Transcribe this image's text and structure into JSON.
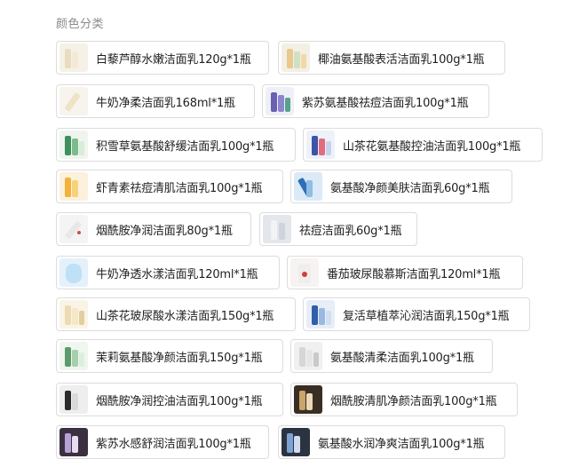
{
  "section_title": "颜色分类",
  "options": [
    {
      "label": "白藜芦醇水嫩洁面乳120g*1瓶",
      "icon": "product-thumbnail"
    },
    {
      "label": "椰油氨基酸表活洁面乳100g*1瓶",
      "icon": "product-thumbnail"
    },
    {
      "label": "牛奶净柔洁面乳168ml*1瓶",
      "icon": "product-thumbnail"
    },
    {
      "label": "紫苏氨基酸祛痘洁面乳100g*1瓶",
      "icon": "product-thumbnail"
    },
    {
      "label": "积雪草氨基酸舒缓洁面乳100g*1瓶",
      "icon": "product-thumbnail"
    },
    {
      "label": "山茶花氨基酸控油洁面乳100g*1瓶",
      "icon": "product-thumbnail"
    },
    {
      "label": "虾青素祛痘清肌洁面乳100g*1瓶",
      "icon": "product-thumbnail"
    },
    {
      "label": "氨基酸净颜美肤洁面乳60g*1瓶",
      "icon": "product-thumbnail"
    },
    {
      "label": "烟酰胺净润洁面乳80g*1瓶",
      "icon": "product-thumbnail"
    },
    {
      "label": "祛痘洁面乳60g*1瓶",
      "icon": "product-thumbnail"
    },
    {
      "label": "牛奶净透水漾洁面乳120ml*1瓶",
      "icon": "product-thumbnail"
    },
    {
      "label": "番茄玻尿酸慕斯洁面乳120ml*1瓶",
      "icon": "product-thumbnail"
    },
    {
      "label": "山茶花玻尿酸水漾洁面乳150g*1瓶",
      "icon": "product-thumbnail"
    },
    {
      "label": "复活草植萃沁润洁面乳150g*1瓶",
      "icon": "product-thumbnail"
    },
    {
      "label": "茉莉氨基酸净颜洁面乳150g*1瓶",
      "icon": "product-thumbnail"
    },
    {
      "label": "氨基酸清柔洁面乳100g*1瓶",
      "icon": "product-thumbnail"
    },
    {
      "label": "烟酰胺净润控油洁面乳100g*1瓶",
      "icon": "product-thumbnail"
    },
    {
      "label": "烟酰胺清肌净颜洁面乳100g*1瓶",
      "icon": "product-thumbnail"
    },
    {
      "label": "紫苏水感舒润洁面乳100g*1瓶",
      "icon": "product-thumbnail"
    },
    {
      "label": "氨基酸水润净爽洁面乳100g*1瓶",
      "icon": "product-thumbnail"
    }
  ],
  "colors": {
    "border": "#dcdcdc",
    "title": "#8a8a8a",
    "text": "#1e1e1e"
  }
}
